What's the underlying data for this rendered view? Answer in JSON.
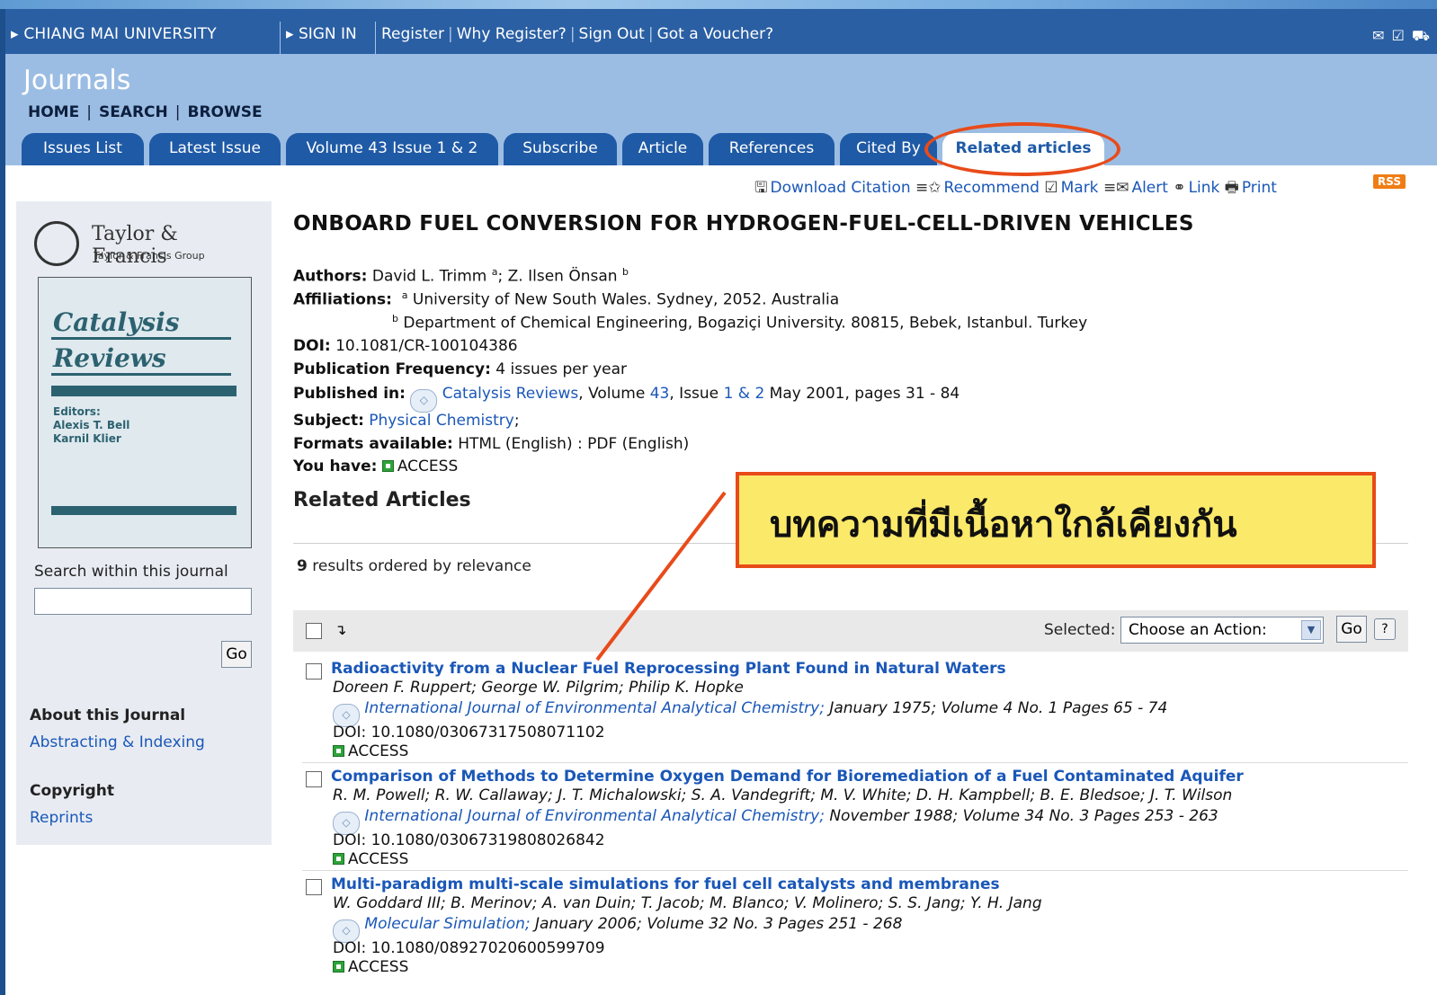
{
  "topbar": {
    "institution": "CHIANG MAI UNIVERSITY",
    "sign_in": "SIGN IN",
    "links": [
      "Register",
      "Why Register?",
      "Sign Out",
      "Got a Voucher?"
    ]
  },
  "header": {
    "section_title": "Journals",
    "nav": [
      "HOME",
      "SEARCH",
      "BROWSE"
    ],
    "tabs": [
      {
        "label": "Issues List"
      },
      {
        "label": "Latest Issue"
      },
      {
        "label": "Volume 43 Issue 1 & 2"
      },
      {
        "label": "Subscribe"
      },
      {
        "label": "Article"
      },
      {
        "label": "References"
      },
      {
        "label": "Cited By"
      },
      {
        "label": "Related articles",
        "active": true
      }
    ]
  },
  "sidebar": {
    "publisher": "Taylor & Francis",
    "publisher_sub": "Taylor & Francis Group",
    "cover_title_1": "Catalysis",
    "cover_title_2": "Reviews",
    "cover_editors_label": "Editors:",
    "cover_editors": [
      "Alexis T. Bell",
      "Karnil Klier"
    ],
    "search_label": "Search within this journal",
    "search_placeholder": "",
    "go_label": "Go",
    "about_heading": "About this Journal",
    "about_link": "Abstracting & Indexing",
    "copyright_heading": "Copyright",
    "copyright_link": "Reprints"
  },
  "tools": {
    "download_citation": "Download Citation",
    "recommend": "Recommend",
    "mark": "Mark",
    "alert": "Alert",
    "link": "Link",
    "print": "Print",
    "rss": "RSS"
  },
  "article": {
    "title": "ONBOARD FUEL CONVERSION FOR HYDROGEN-FUEL-CELL-DRIVEN VEHICLES",
    "authors_label": "Authors:",
    "author_1": "David L. Trimm",
    "author_2": "Z. Ilsen Önsan",
    "affiliations_label": "Affiliations:",
    "affiliation_a": "University of New South Wales. Sydney, 2052. Australia",
    "affiliation_b": "Department of Chemical Engineering, Bogaziçi University. 80815, Bebek, Istanbul. Turkey",
    "doi_label": "DOI:",
    "doi": "10.1081/CR-100104386",
    "frequency_label": "Publication Frequency:",
    "frequency": "4 issues per year",
    "published_label": "Published in:",
    "journal": "Catalysis Reviews",
    "volume_prefix": ", Volume ",
    "volume": "43",
    "issue_prefix": ", Issue ",
    "issue": "1 & 2",
    "published_rest": " May 2001, pages 31 - 84",
    "subject_label": "Subject:",
    "subject": "Physical Chemistry",
    "formats_label": "Formats available:",
    "formats": "HTML (English) : PDF (English)",
    "you_have_label": "You have:",
    "access": "ACCESS"
  },
  "related": {
    "heading": "Related Articles",
    "count": "9",
    "count_text": "results ordered by relevance",
    "selected_label": "Selected:",
    "action_select": "Choose an Action:",
    "go_label": "Go",
    "help_label": "?",
    "results": [
      {
        "title": "Radioactivity from a Nuclear Fuel Reprocessing Plant Found in Natural Waters",
        "authors": "Doreen F. Ruppert;  George W. Pilgrim;  Philip K. Hopke",
        "journal": "International Journal of Environmental Analytical Chemistry;",
        "details": " January 1975; Volume 4 No. 1 Pages 65 - 74",
        "doi": "DOI: 10.1080/03067317508071102",
        "access": "ACCESS"
      },
      {
        "title": "Comparison of Methods to Determine Oxygen Demand for Bioremediation of a Fuel Contaminated Aquifer",
        "authors": "R. M. Powell;  R. W. Callaway;  J. T. Michalowski;  S. A. Vandegrift;  M. V. White;  D. H. Kampbell;  B. E. Bledsoe;  J. T. Wilson",
        "journal": "International Journal of Environmental Analytical Chemistry;",
        "details": " November 1988; Volume 34 No. 3 Pages 253 - 263",
        "doi": "DOI: 10.1080/03067319808026842",
        "access": "ACCESS"
      },
      {
        "title": "Multi-paradigm multi-scale simulations for fuel cell catalysts and membranes",
        "authors": "W. Goddard III;  B. Merinov;  A. van Duin;  T. Jacob;  M. Blanco;  V. Molinero;  S. S. Jang;  Y. H. Jang",
        "journal": "Molecular Simulation;",
        "details": " January 2006; Volume 32 No. 3 Pages 251 - 268",
        "doi": "DOI: 10.1080/08927020600599709",
        "access": "ACCESS"
      }
    ]
  },
  "callout": {
    "text": "บทความที่มีเนื้อหาใกล้เคียงกัน",
    "border_color": "#e84b1a",
    "fill_color": "#fbe96a"
  }
}
